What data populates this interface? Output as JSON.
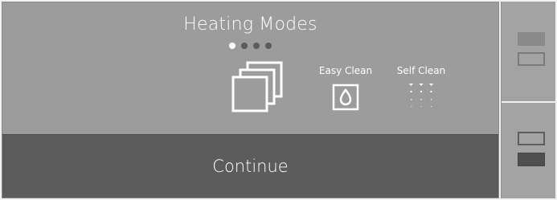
{
  "screen": {
    "title": "Heating Modes",
    "pager": {
      "total": 4,
      "active_index": 0
    },
    "modes": [
      {
        "name": "stacked-pans",
        "label": "",
        "icon": "stacked-pans-icon"
      },
      {
        "name": "easy-clean",
        "label": "Easy Clean",
        "icon": "water-drop-icon"
      },
      {
        "name": "self-clean",
        "label": "Self Clean",
        "icon": "self-clean-dots-icon"
      }
    ]
  },
  "footer": {
    "continue_label": "Continue"
  },
  "side_panel": {
    "top_button": {
      "icon": "upper-selected-rect-icon"
    },
    "bottom_button": {
      "icon": "lower-selected-rect-icon"
    }
  },
  "colors": {
    "panel": "#9c9c9c",
    "continue": "#5c5c5c",
    "side": "#a3a3a3",
    "text": "#ffffff",
    "dot_inactive": "#5c5c5c"
  }
}
